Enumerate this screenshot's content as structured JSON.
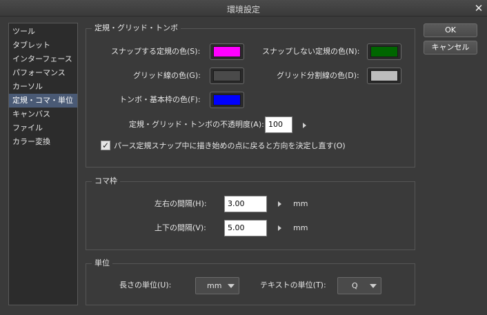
{
  "window": {
    "title": "環境設定"
  },
  "sidebar": {
    "items": [
      {
        "label": "ツール",
        "selected": false
      },
      {
        "label": "タブレット",
        "selected": false
      },
      {
        "label": "インターフェース",
        "selected": false
      },
      {
        "label": "パフォーマンス",
        "selected": false
      },
      {
        "label": "カーソル",
        "selected": false
      },
      {
        "label": "定規・コマ・単位",
        "selected": true
      },
      {
        "label": "キャンバス",
        "selected": false
      },
      {
        "label": "ファイル",
        "selected": false
      },
      {
        "label": "カラー変換",
        "selected": false
      }
    ]
  },
  "ruler_group": {
    "title": "定規・グリッド・トンボ",
    "snap_color_label": "スナップする定規の色(S):",
    "snap_color": "#ff00ff",
    "nosnap_color_label": "スナップしない定規の色(N):",
    "nosnap_color": "#006600",
    "grid_color_label": "グリッド線の色(G):",
    "grid_color": "#4a4a4a",
    "subgrid_color_label": "グリッド分割線の色(D):",
    "subgrid_color": "#bdbdbd",
    "crop_color_label": "トンボ・基本枠の色(F):",
    "crop_color": "#0000ff",
    "opacity_label": "定規・グリッド・トンボの不透明度(A):",
    "opacity_value": "100",
    "perspective_checkbox_label": "パース定規スナップ中に描き始めの点に戻ると方向を決定し直す(O)",
    "perspective_checked": true
  },
  "frame_group": {
    "title": "コマ枠",
    "horizontal_label": "左右の間隔(H):",
    "horizontal_value": "3.00",
    "horizontal_unit": "mm",
    "vertical_label": "上下の間隔(V):",
    "vertical_value": "5.00",
    "vertical_unit": "mm"
  },
  "unit_group": {
    "title": "単位",
    "length_label": "長さの単位(U):",
    "length_value": "mm",
    "text_label": "テキストの単位(T):",
    "text_value": "Q"
  },
  "buttons": {
    "ok": "OK",
    "cancel": "キャンセル"
  },
  "icons": {
    "close": "✕",
    "check": "✓"
  }
}
